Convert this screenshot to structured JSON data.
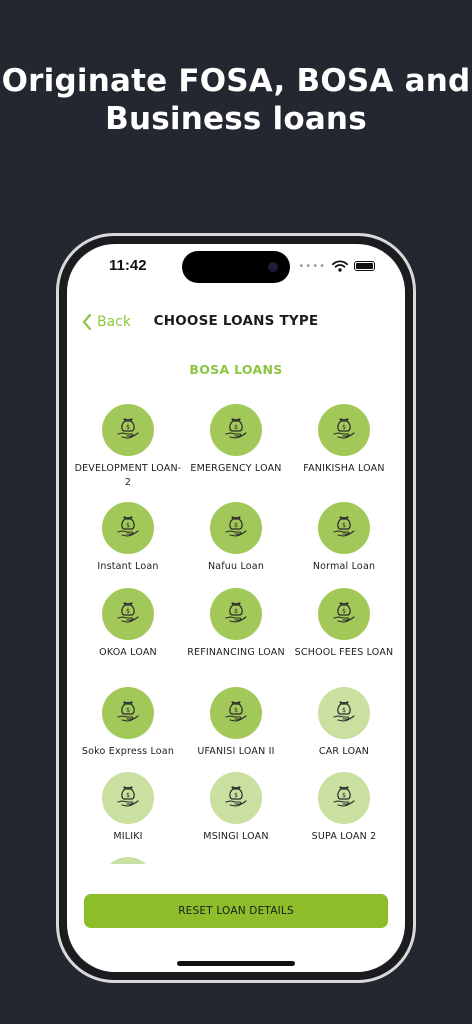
{
  "promo": {
    "headline_line1": "Originate FOSA, BOSA and",
    "headline_line2": "Business loans"
  },
  "status_bar": {
    "time": "11:42",
    "signal_icon": "signal-dots-icon",
    "wifi_icon": "wifi-icon",
    "battery_icon": "battery-icon"
  },
  "nav": {
    "back_label": "Back",
    "back_icon": "chevron-left-icon",
    "title": "CHOOSE LOANS TYPE"
  },
  "section": {
    "title": "BOSA LOANS"
  },
  "colors": {
    "accent": "#8cc63f",
    "circle_dark": "#a2c85a",
    "circle_light": "#c9e0a0",
    "button": "#8dbe2a"
  },
  "loans": [
    {
      "label": "DEVELOPMENT LOAN-2",
      "shade": "dark"
    },
    {
      "label": "EMERGENCY LOAN",
      "shade": "dark"
    },
    {
      "label": "FANIKISHA LOAN",
      "shade": "dark"
    },
    {
      "label": "Instant Loan",
      "shade": "dark"
    },
    {
      "label": "Nafuu Loan",
      "shade": "dark"
    },
    {
      "label": "Normal Loan",
      "shade": "dark"
    },
    {
      "label": "OKOA LOAN",
      "shade": "dark"
    },
    {
      "label": "REFINANCING LOAN",
      "shade": "dark"
    },
    {
      "label": "SCHOOL FEES LOAN",
      "shade": "dark"
    },
    {
      "label": "Soko Express Loan",
      "shade": "dark"
    },
    {
      "label": "UFANISI LOAN II",
      "shade": "dark"
    },
    {
      "label": "CAR LOAN",
      "shade": "light"
    },
    {
      "label": "MILIKI",
      "shade": "light"
    },
    {
      "label": "MSINGI LOAN",
      "shade": "light"
    },
    {
      "label": "SUPA LOAN 2",
      "shade": "light"
    },
    {
      "label": "",
      "shade": "light"
    }
  ],
  "loan_icon": "money-bag-hand-icon",
  "footer": {
    "reset_label": "RESET LOAN DETAILS"
  }
}
